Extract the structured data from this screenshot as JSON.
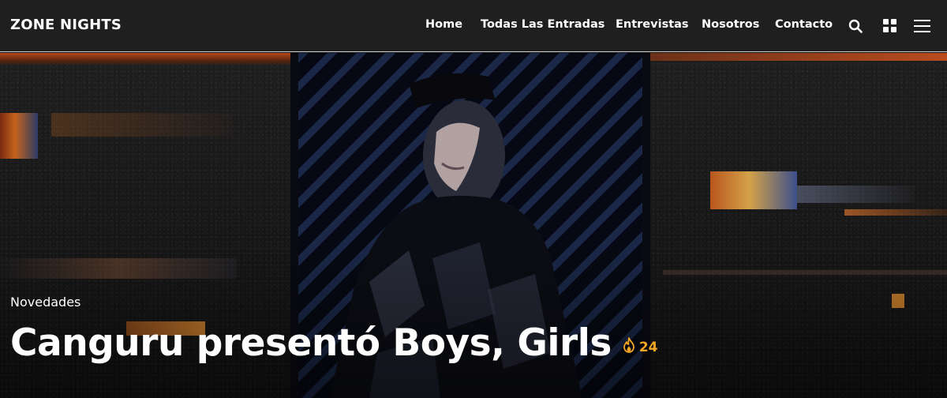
{
  "site": {
    "logo": "ZONE NIGHTS"
  },
  "nav": {
    "items": [
      {
        "label": "Home"
      },
      {
        "label": "Todas Las Entradas"
      },
      {
        "label": "Entrevistas"
      },
      {
        "label": "Nosotros"
      },
      {
        "label": "Contacto"
      }
    ],
    "icons": [
      "search-icon",
      "grid-icon",
      "menu-icon"
    ]
  },
  "hero": {
    "category": "Novedades",
    "title": "Canguru presentó Boys, Girls",
    "hot_count": "24",
    "hot_icon": "flame-icon"
  },
  "colors": {
    "topbar_bg": "#1f1f1f",
    "accent": "#f5a623",
    "text": "#ffffff"
  }
}
